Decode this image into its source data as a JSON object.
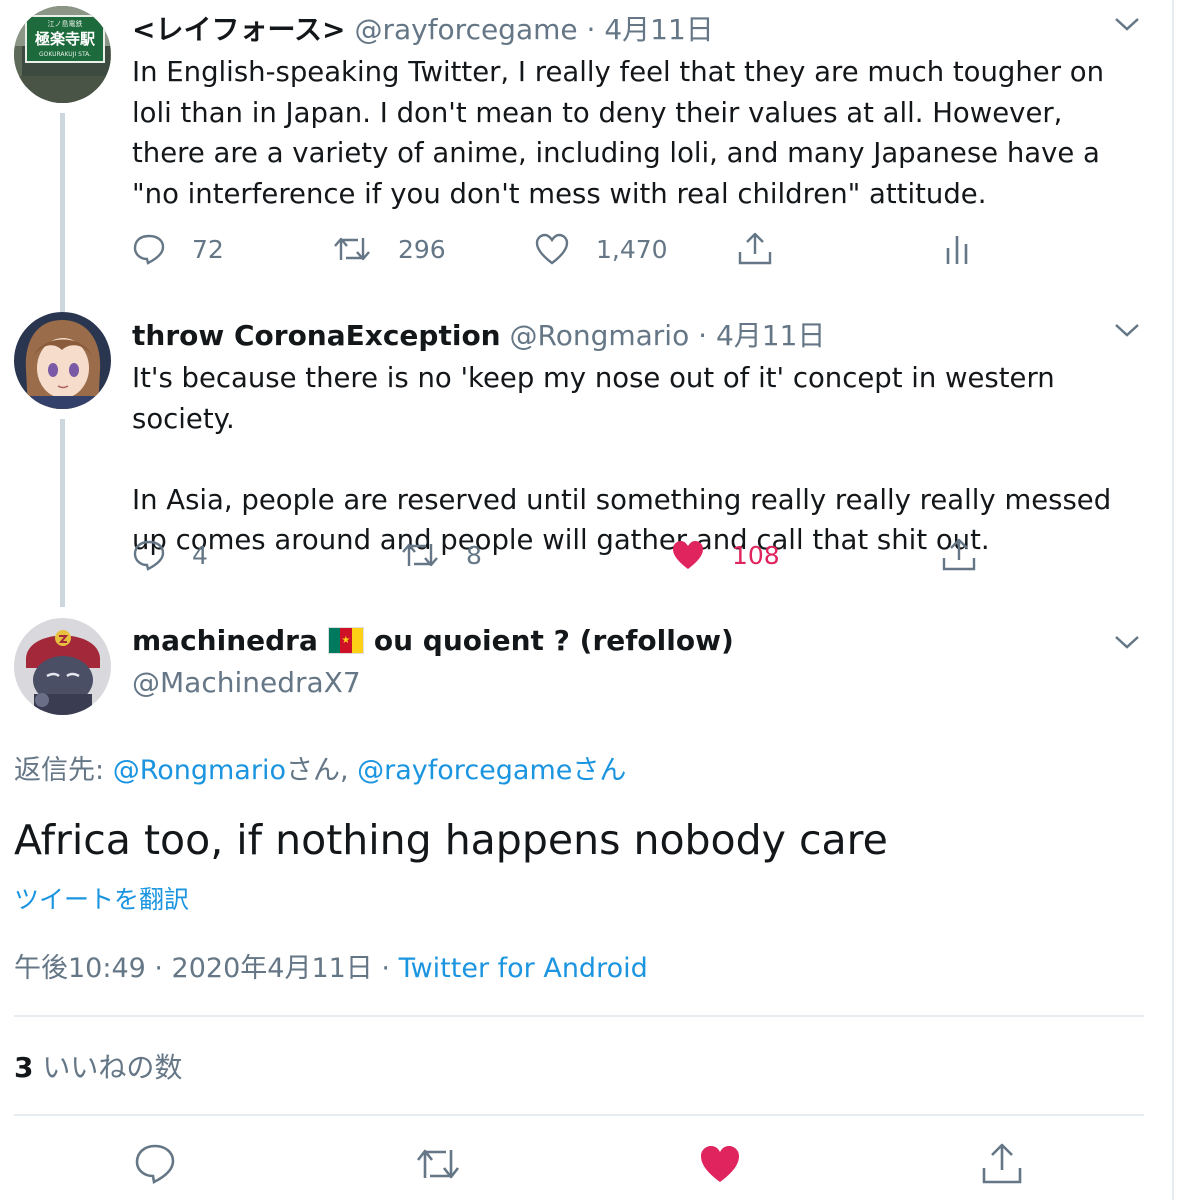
{
  "tweets": [
    {
      "name": "<レイフォース>",
      "handle": "@rayforcegame",
      "separator": "·",
      "date": "4月11日",
      "text": "In English-speaking Twitter, I really feel that they are much tougher on loli than in Japan. I don't mean to deny their values at all. However, there are a variety of anime, including loli, and many Japanese have a \"no interference if you don't mess with real children\" attitude.",
      "replies": "72",
      "retweets": "296",
      "likes": "1,470",
      "avatar_sign_top": "江ノ島電鉄",
      "avatar_sign_main": "極楽寺駅",
      "avatar_sign_bottom": "GOKURAKUJI STA."
    },
    {
      "name": "throw CoronaException",
      "handle": "@Rongmario",
      "separator": "·",
      "date": "4月11日",
      "text": "It's because there is no 'keep my nose out of it' concept in western society.\n\nIn Asia, people are reserved until something really really really messed up comes around and people will gather and call that shit out.",
      "replies": "4",
      "retweets": "8",
      "likes": "108",
      "liked": true
    }
  ],
  "main_tweet": {
    "name_part1": "machinedra",
    "flag": "cameroon-flag",
    "name_part2": "ou quoient ? (refollow)",
    "handle": "@MachinedraX7",
    "reply_prefix": "返信先: ",
    "reply_user1": "@Rongmario",
    "reply_suffix1": "さん, ",
    "reply_user2": "@rayforcegame",
    "reply_suffix2": "さん",
    "text": "Africa too, if nothing happens nobody care",
    "translate_label": "ツイートを翻訳",
    "time": "午後10:49 · 2020年4月11日 · ",
    "source": "Twitter for Android",
    "likes_count": "3",
    "likes_label": " いいねの数"
  },
  "colors": {
    "accent": "#1b95e0",
    "like": "#e0245e",
    "muted": "#657786",
    "text": "#14171a",
    "thread_line": "#ccd6dd",
    "flag_green": "#007a5e",
    "flag_red": "#ce1126",
    "flag_yellow": "#fcd116"
  },
  "icons": [
    "reply-icon",
    "retweet-icon",
    "heart-icon",
    "share-icon",
    "analytics-icon",
    "chevron-down-icon"
  ]
}
